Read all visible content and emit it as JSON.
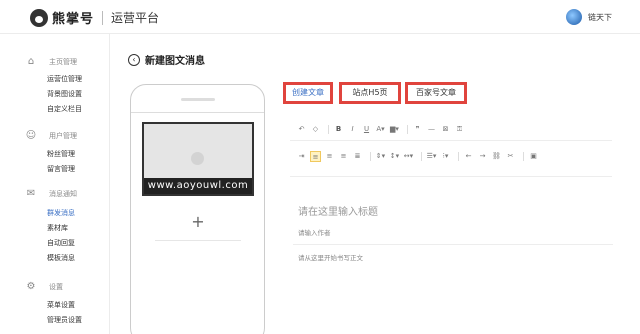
{
  "header": {
    "brand": "熊掌号",
    "platform": "运营平台",
    "user_name": "链天下"
  },
  "sidebar": {
    "groups": [
      {
        "title": "主页管理",
        "icon": "home-icon",
        "items": [
          "运营位管理",
          "背景图设置",
          "自定义栏目"
        ]
      },
      {
        "title": "用户管理",
        "icon": "user-icon",
        "items": [
          "粉丝管理",
          "留言管理"
        ]
      },
      {
        "title": "消息通知",
        "icon": "mail-icon",
        "items": [
          "群发消息",
          "素材库",
          "自动回复",
          "模板消息"
        ]
      },
      {
        "title": "设置",
        "icon": "gear-icon",
        "items": [
          "菜单设置",
          "管理员设置"
        ]
      }
    ],
    "active_item": "群发消息"
  },
  "page": {
    "title": "新建图文消息"
  },
  "preview": {
    "watermark": "www.aoyouwl.com",
    "add_label": "+"
  },
  "tabs": [
    "创建文章",
    "站点H5页",
    "百家号文章"
  ],
  "editor": {
    "title_placeholder": "请在这里输入标题",
    "author_placeholder": "请输入作者",
    "body_placeholder": "请从这里开始书写正文"
  },
  "colors": {
    "highlight_border": "#e0443d",
    "active_link": "#3a6fc4"
  }
}
